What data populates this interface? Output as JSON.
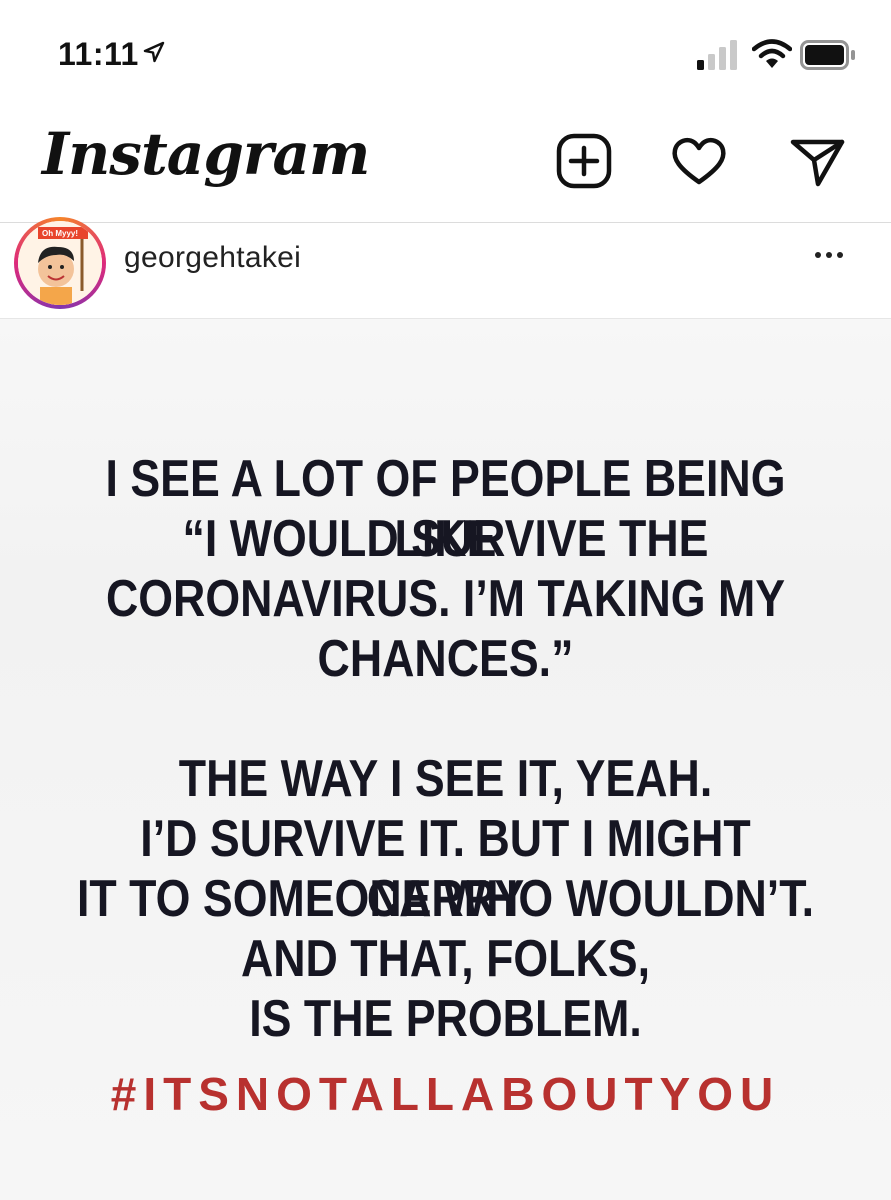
{
  "status_bar": {
    "time": "11:11",
    "icons": [
      "location-arrow-icon",
      "cellular-signal-icon",
      "wifi-icon",
      "battery-icon"
    ]
  },
  "header": {
    "app_title": "Instagram",
    "icons": [
      "new-post-icon",
      "heart-icon",
      "direct-message-icon"
    ]
  },
  "post": {
    "username": "georgehtakei",
    "avatar_sign_text": "Oh Myyy!",
    "image_text": {
      "lines": [
        "I SEE A LOT OF PEOPLE BEING LIKE",
        "“I WOULD SURVIVE THE",
        "CORONAVIRUS. I’M TAKING MY",
        "CHANCES.”",
        "THE WAY I SEE IT, YEAH.",
        "I’D SURVIVE IT. BUT I MIGHT CARRY",
        "IT TO SOMEONE WHO WOULDN’T.",
        "AND THAT, FOLKS,",
        "IS THE PROBLEM."
      ],
      "hashtag": "#ITSNOTALLABOUTYOU"
    }
  },
  "colors": {
    "hashtag": "#b8312f",
    "meme_text": "#161622",
    "story_ring": [
      "#f58529",
      "#dd2a7b",
      "#8134af"
    ]
  }
}
